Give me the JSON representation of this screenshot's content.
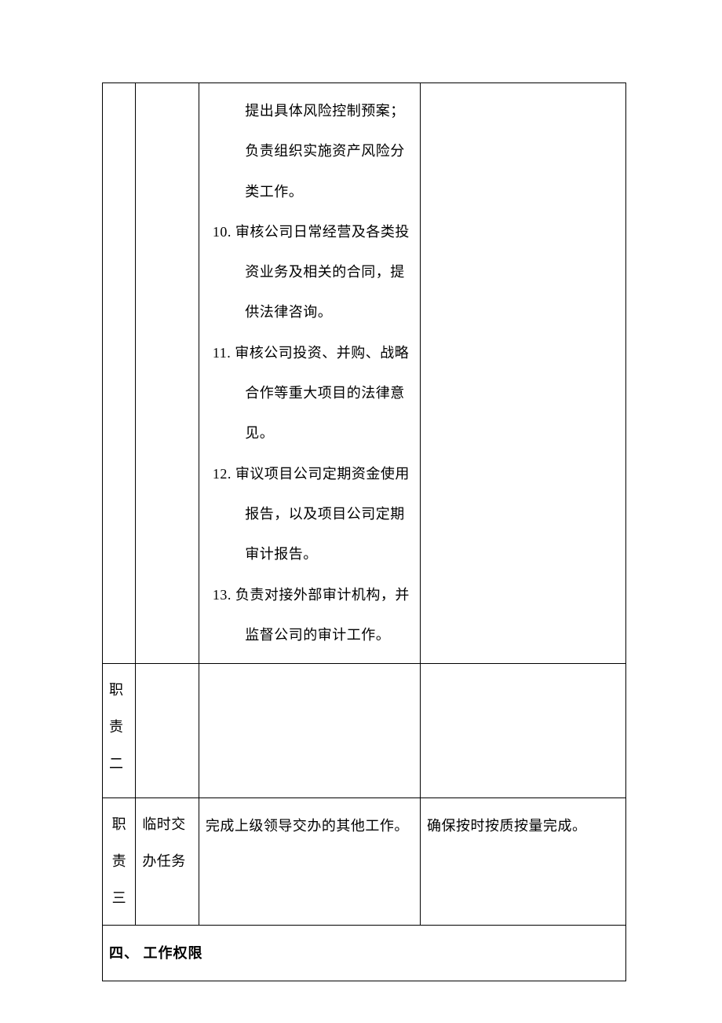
{
  "row1": {
    "tasks_pretext": "提出具体风险控制预案；负责组织实施资产风险分类工作。",
    "items": [
      {
        "num": "10.",
        "text": "审核公司日常经营及各类投资业务及相关的合同，提供法律咨询。"
      },
      {
        "num": "11.",
        "text": "审核公司投资、并购、战略合作等重大项目的法律意见。"
      },
      {
        "num": "12.",
        "text": "审议项目公司定期资金使用报告，以及项目公司定期审计报告。"
      },
      {
        "num": "13.",
        "text": "负责对接外部审计机构，并监督公司的审计工作。"
      }
    ]
  },
  "row2": {
    "label": "职责二"
  },
  "row3": {
    "label": "职责三",
    "col2": "临时交办任务",
    "col3": "完成上级领导交办的其他工作。",
    "col4": "确保按时按质按量完成。"
  },
  "section4": "四、 工作权限"
}
